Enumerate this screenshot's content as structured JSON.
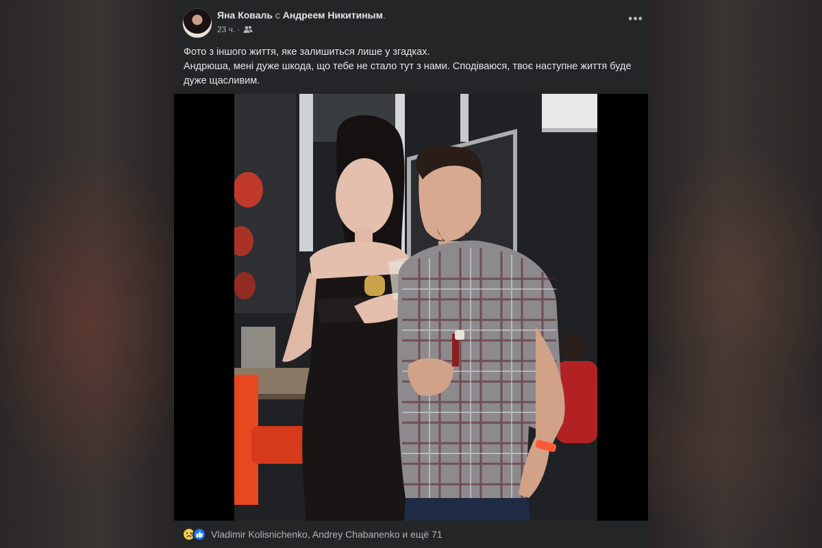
{
  "post": {
    "author": "Яна Коваль",
    "with_word": "с",
    "tagged": "Андреем Никитиным",
    "tagged_suffix": ".",
    "time": "23 ч.",
    "separator": "·",
    "audience_icon": "friends-icon",
    "more_icon": "more-horizontal-icon",
    "more_glyph": "•••",
    "text": [
      "Фото з іншого життя, яке залишиться лише у згадках.",
      "Андрюша, мені дуже шкода, що тебе не стало тут з нами. Сподіваюся, твоє наступне життя буде дуже щасливим."
    ]
  },
  "reactions": {
    "icons": [
      "sad-reaction-icon",
      "like-reaction-icon"
    ],
    "summary": "Vladimir Kolisnichenko, Andrey Chabanenko и ещё 71"
  },
  "colors": {
    "card_bg": "#242526",
    "text_primary": "#e4e6eb",
    "text_secondary": "#b0b3b8",
    "like_blue": "#1877f2"
  }
}
